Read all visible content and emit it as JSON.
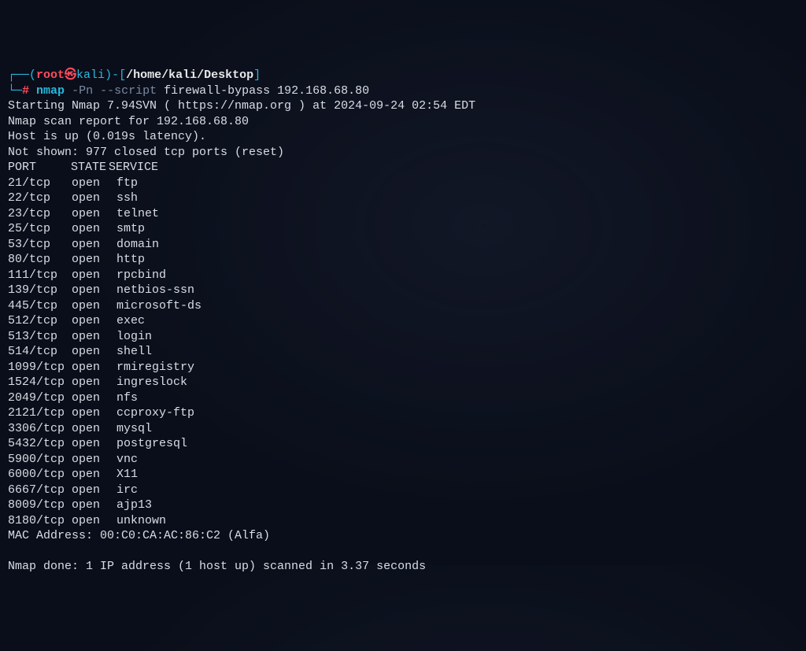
{
  "prompt": {
    "deco_open": "┌──(",
    "user": "root",
    "skull": "㉿",
    "host": "kali",
    "deco_mid": ")-[",
    "path": "/home/kali/Desktop",
    "deco_close": "]",
    "line2_deco": "└─",
    "hash": "#",
    "cmd": "nmap",
    "flags": "-Pn --script",
    "args": "firewall-bypass 192.168.68.80"
  },
  "output": {
    "starting": "Starting Nmap 7.94SVN ( https://nmap.org ) at 2024-09-24 02:54 EDT",
    "report": "Nmap scan report for 192.168.68.80",
    "host_up": "Host is up (0.019s latency).",
    "not_shown": "Not shown: 977 closed tcp ports (reset)",
    "hdr_port": "PORT",
    "hdr_state": "STATE",
    "hdr_service": "SERVICE",
    "mac": "MAC Address: 00:C0:CA:AC:86:C2 (Alfa)",
    "done": "Nmap done: 1 IP address (1 host up) scanned in 3.37 seconds"
  },
  "ports": [
    {
      "port": "21/tcp",
      "state": "open",
      "service": "ftp"
    },
    {
      "port": "22/tcp",
      "state": "open",
      "service": "ssh"
    },
    {
      "port": "23/tcp",
      "state": "open",
      "service": "telnet"
    },
    {
      "port": "25/tcp",
      "state": "open",
      "service": "smtp"
    },
    {
      "port": "53/tcp",
      "state": "open",
      "service": "domain"
    },
    {
      "port": "80/tcp",
      "state": "open",
      "service": "http"
    },
    {
      "port": "111/tcp",
      "state": "open",
      "service": "rpcbind"
    },
    {
      "port": "139/tcp",
      "state": "open",
      "service": "netbios-ssn"
    },
    {
      "port": "445/tcp",
      "state": "open",
      "service": "microsoft-ds"
    },
    {
      "port": "512/tcp",
      "state": "open",
      "service": "exec"
    },
    {
      "port": "513/tcp",
      "state": "open",
      "service": "login"
    },
    {
      "port": "514/tcp",
      "state": "open",
      "service": "shell"
    },
    {
      "port": "1099/tcp",
      "state": "open",
      "service": "rmiregistry"
    },
    {
      "port": "1524/tcp",
      "state": "open",
      "service": "ingreslock"
    },
    {
      "port": "2049/tcp",
      "state": "open",
      "service": "nfs"
    },
    {
      "port": "2121/tcp",
      "state": "open",
      "service": "ccproxy-ftp"
    },
    {
      "port": "3306/tcp",
      "state": "open",
      "service": "mysql"
    },
    {
      "port": "5432/tcp",
      "state": "open",
      "service": "postgresql"
    },
    {
      "port": "5900/tcp",
      "state": "open",
      "service": "vnc"
    },
    {
      "port": "6000/tcp",
      "state": "open",
      "service": "X11"
    },
    {
      "port": "6667/tcp",
      "state": "open",
      "service": "irc"
    },
    {
      "port": "8009/tcp",
      "state": "open",
      "service": "ajp13"
    },
    {
      "port": "8180/tcp",
      "state": "open",
      "service": "unknown"
    }
  ]
}
